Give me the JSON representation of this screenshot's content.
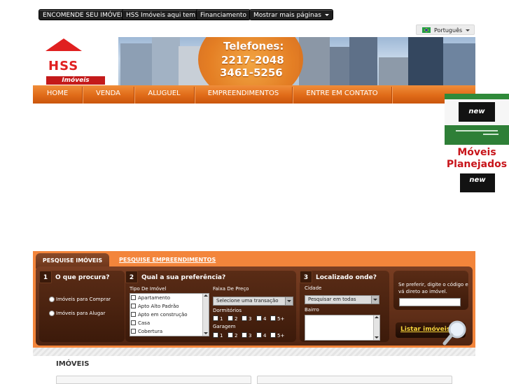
{
  "topbar": {
    "buttons": [
      "ENCOMENDE SEU IMÓVEL",
      "HSS Imóveis aqui tem",
      "Financiamento",
      "Mostrar mais páginas"
    ],
    "language": "Português"
  },
  "header": {
    "logo_letters": "HSS",
    "logo_tag": "Imóveis",
    "phone_label": "Telefones:",
    "phone_1": "2217-2048",
    "phone_2": "3461-5256"
  },
  "nav": {
    "items": [
      "HOME",
      "VENDA",
      "ALUGUEL",
      "EMPREENDIMENTOS",
      "ENTRE EM CONTATO"
    ]
  },
  "ads": {
    "ad1_logo": "new",
    "ad2_title": "Móveis Planejados",
    "ad2_logo": "new"
  },
  "search": {
    "tab_active": "PESQUISE IMÓVEIS",
    "tab_inactive": "PESQUISE EMPREENDIMENTOS",
    "box1": {
      "num": "1",
      "title": "O que procura?",
      "options": [
        "Imóveis para Comprar",
        "Imóveis para Alugar"
      ]
    },
    "box2": {
      "num": "2",
      "title": "Qual a sua preferência?",
      "type_label": "Tipo De Imóvel",
      "types": [
        "Apartamento",
        "Apto Alto Padrão",
        "Apto em construção",
        "Casa",
        "Cobertura"
      ],
      "price_label": "Faixa De Preço",
      "price_select": "Selecione uma transação",
      "dorm_label": "Dormitórios",
      "garage_label": "Garagem",
      "counts": [
        "1",
        "2",
        "3",
        "4",
        "5+"
      ]
    },
    "box3": {
      "num": "3",
      "title": "Localizado onde?",
      "city_label": "Cidade",
      "city_select": "Pesquisar em todas",
      "district_label": "Bairro"
    },
    "box4": {
      "hint": "Se preferir, digite o código e vá direto ao imóvel.",
      "button": "Listar imóveis"
    }
  },
  "content": {
    "section_title": "IMÓVEIS"
  },
  "colors": {
    "nav_orange": "#e06b18",
    "panel_orange": "#f3853b",
    "panel_brown": "#4e2411",
    "brand_red": "#e02020"
  }
}
